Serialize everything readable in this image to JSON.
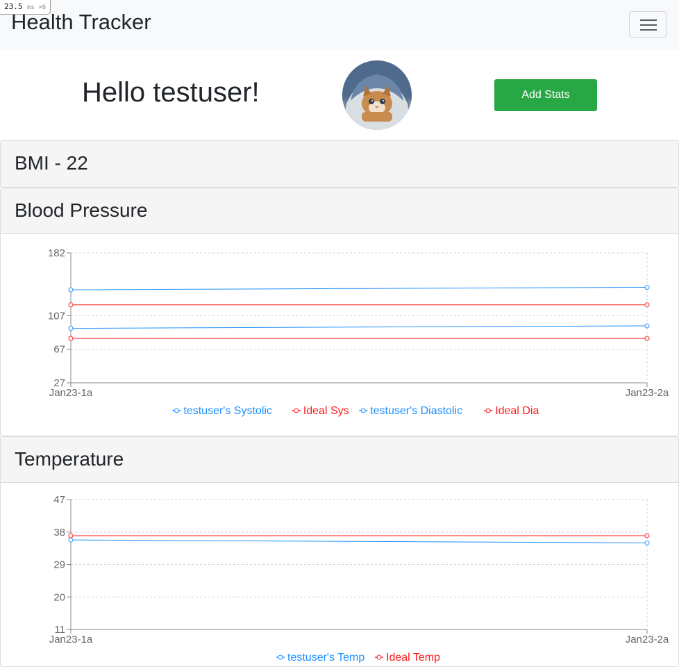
{
  "perf": {
    "value": "23.5",
    "unit": "ms ×6"
  },
  "navbar": {
    "brand": "Health Tracker",
    "toggle_icon": "hamburger-menu-icon"
  },
  "greeting": {
    "text": "Hello testuser!"
  },
  "avatar": {
    "description_icon": "kitten-avatar"
  },
  "actions": {
    "add_stats_label": "Add Stats"
  },
  "colors": {
    "user": "#1e90ff",
    "ideal": "#ff1a1a",
    "button": "#28a745"
  },
  "bmi": {
    "title": "BMI - 22"
  },
  "blood_pressure": {
    "title": "Blood Pressure"
  },
  "temperature": {
    "title": "Temperature"
  },
  "chart_data": [
    {
      "type": "line",
      "title": "Blood Pressure",
      "categories": [
        "Jan23-1a",
        "Jan23-2a"
      ],
      "y_ticks": [
        27,
        67,
        107,
        182
      ],
      "ylim": [
        27,
        182
      ],
      "grid": true,
      "legend_position": "bottom",
      "series": [
        {
          "name": "testuser's Systolic",
          "color": "#1e90ff",
          "values": [
            138,
            141
          ]
        },
        {
          "name": "Ideal Sys",
          "color": "#ff1a1a",
          "values": [
            120,
            120
          ]
        },
        {
          "name": "testuser's Diastolic",
          "color": "#1e90ff",
          "values": [
            92,
            95
          ]
        },
        {
          "name": "Ideal Dia",
          "color": "#ff1a1a",
          "values": [
            80,
            80
          ]
        }
      ]
    },
    {
      "type": "line",
      "title": "Temperature",
      "categories": [
        "Jan23-1a",
        "Jan23-2a"
      ],
      "y_ticks": [
        11,
        20,
        29,
        38,
        47
      ],
      "ylim": [
        11,
        47
      ],
      "grid": true,
      "legend_position": "bottom",
      "series": [
        {
          "name": "testuser's Temp",
          "color": "#1e90ff",
          "values": [
            35.8,
            35
          ]
        },
        {
          "name": "Ideal Temp",
          "color": "#ff1a1a",
          "values": [
            37,
            37
          ]
        }
      ]
    }
  ]
}
